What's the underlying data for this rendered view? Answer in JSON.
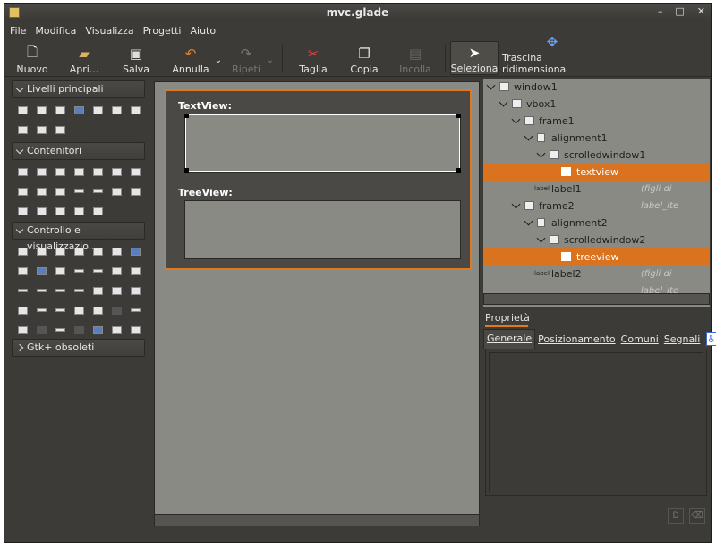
{
  "window": {
    "title": "mvc.glade",
    "minimize": "–",
    "maximize": "□",
    "close": "✕"
  },
  "menu": [
    "File",
    "Modifica",
    "Visualizza",
    "Progetti",
    "Aiuto"
  ],
  "toolbar": {
    "nuovo": "Nuovo",
    "apri": "Apri...",
    "salva": "Salva",
    "annulla": "Annulla",
    "ripeti": "Ripeti",
    "taglia": "Taglia",
    "copia": "Copia",
    "incolla": "Incolla",
    "seleziona": "Seleziona",
    "trascina": "Trascina ridimensiona"
  },
  "palette": {
    "groups": [
      "Livelli principali",
      "Contenitori",
      "Controllo e visualizzazio...",
      "Gtk+ obsoleti"
    ]
  },
  "canvas": {
    "textview_label": "TextView:",
    "treeview_label": "TreeView:"
  },
  "tree": {
    "items": [
      "window1",
      "vbox1",
      "frame1",
      "alignment1",
      "scrolledwindow1",
      "textview",
      "label1",
      "frame2",
      "alignment2",
      "scrolledwindow2",
      "treeview",
      "label2"
    ],
    "hint1": "(figli di label_ite",
    "hint2": "(figli di label_ite"
  },
  "properties": {
    "title": "Proprietà",
    "tabs": [
      "Generale",
      "Posizionamento",
      "Comuni",
      "Segnali"
    ],
    "a11y": "♿"
  },
  "colors": {
    "accent": "#e07a1e",
    "selected": "#d9731f",
    "bg": "#3c3b37"
  }
}
